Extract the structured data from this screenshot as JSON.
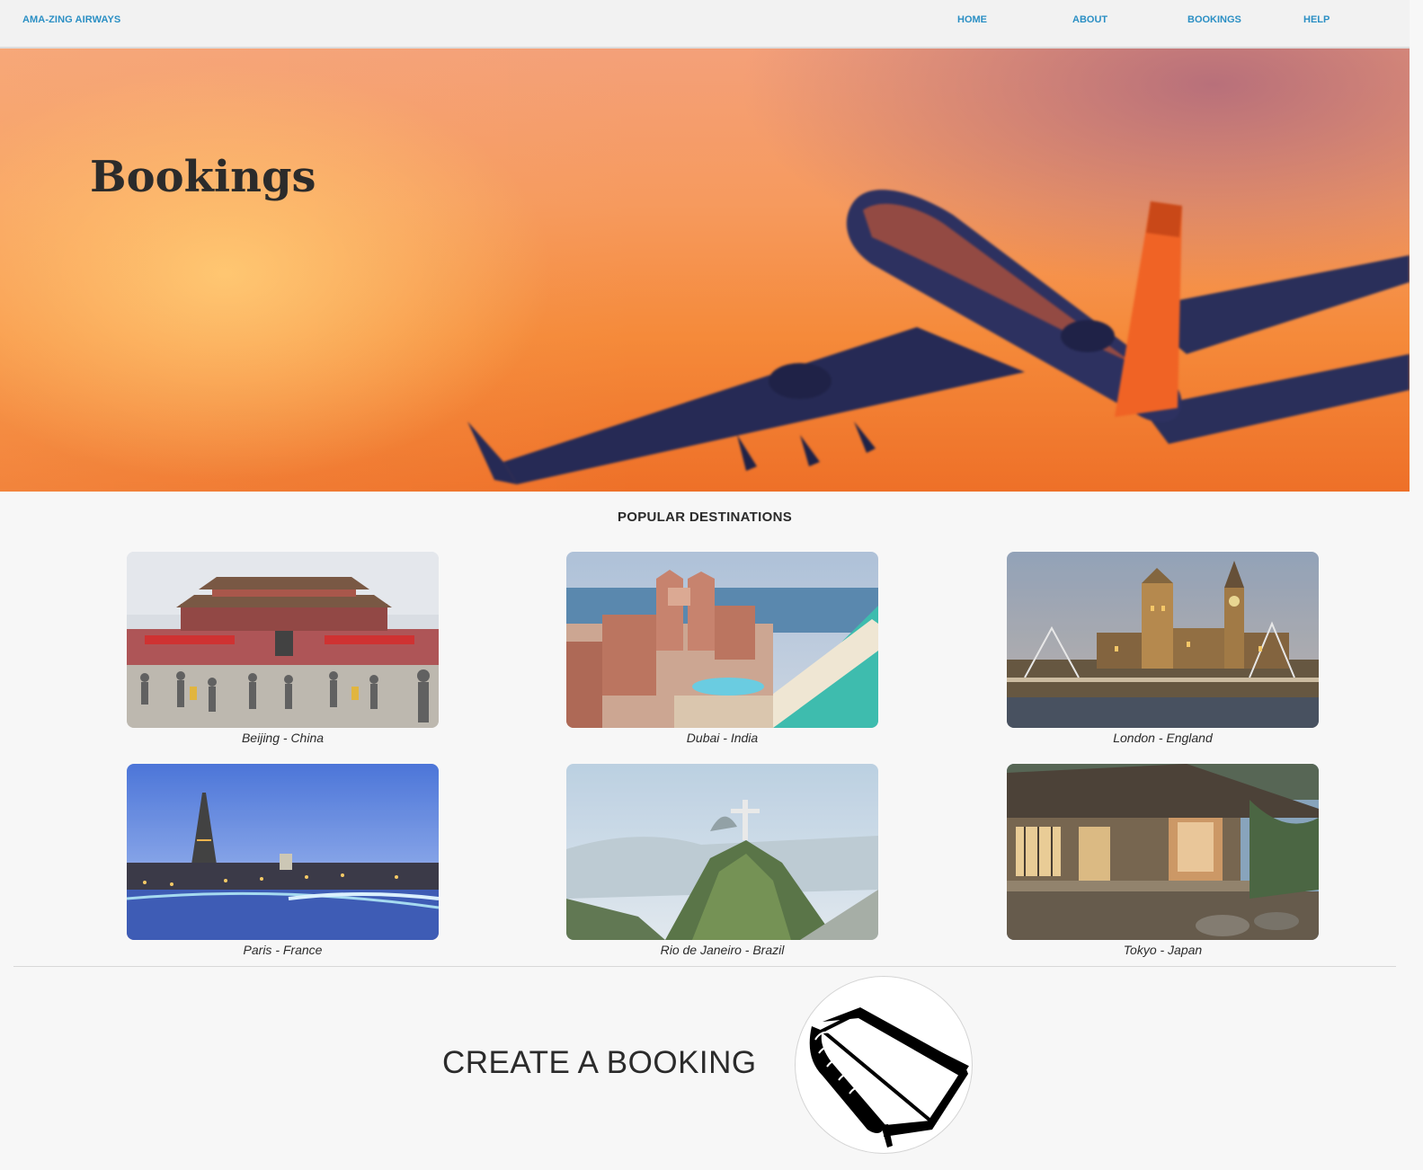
{
  "nav": {
    "brand": "AMA-ZING AIRWAYS",
    "links": [
      "HOME",
      "ABOUT",
      "BOOKINGS",
      "HELP"
    ]
  },
  "hero": {
    "title": "Bookings"
  },
  "destinations": {
    "title": "POPULAR DESTINATIONS",
    "items": [
      {
        "caption": "Beijing - China"
      },
      {
        "caption": "Dubai - India"
      },
      {
        "caption": "London - England"
      },
      {
        "caption": "Paris - France"
      },
      {
        "caption": "Rio de Janeiro - Brazil"
      },
      {
        "caption": "Tokyo - Japan"
      }
    ]
  },
  "create": {
    "label": "CREATE A BOOKING",
    "icon": "book-icon"
  },
  "colors": {
    "link": "#2b8fc4",
    "text": "#2b2b2b",
    "background": "#f7f7f7"
  }
}
